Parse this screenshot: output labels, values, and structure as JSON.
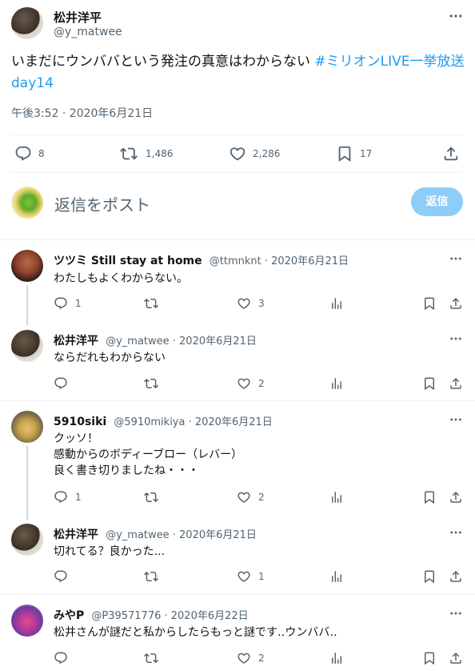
{
  "main": {
    "author_name": "松井洋平",
    "author_handle": "@y_matwee",
    "text_main": "いまだにウンババという発注の真意はわからない ",
    "hashtag_part1": "#ミリオンLIVE一挙放送",
    "hashtag_part2": "day14",
    "timestamp": "午後3:52 · 2020年6月21日",
    "replies": "8",
    "retweets": "1,486",
    "likes": "2,286",
    "bookmarks": "17"
  },
  "composer": {
    "placeholder": "返信をポスト",
    "button": "返信"
  },
  "replies": [
    {
      "name": "ツツミ Still stay at home",
      "meta": "@ttmnknt · 2020年6月21日",
      "lines": [
        "わたしもよくわからない。"
      ],
      "replies": "1",
      "retweets": "",
      "likes": "3"
    },
    {
      "name": "松井洋平",
      "meta": "@y_matwee · 2020年6月21日",
      "lines": [
        "ならだれもわからない"
      ],
      "replies": "",
      "retweets": "",
      "likes": "2"
    },
    {
      "name": "5910siki",
      "meta": "@5910mikiya · 2020年6月21日",
      "lines": [
        "クッソ！",
        "感動からのボディーブロー（レバー）",
        "良く書き切りましたね・・・"
      ],
      "replies": "1",
      "retweets": "",
      "likes": "2"
    },
    {
      "name": "松井洋平",
      "meta": "@y_matwee · 2020年6月21日",
      "lines": [
        "切れてる？良かった..."
      ],
      "replies": "",
      "retweets": "",
      "likes": "1"
    },
    {
      "name": "みやP",
      "meta": "@P39571776 · 2020年6月22日",
      "lines": [
        "松井さんが謎だと私からしたらもっと謎です‥ウンババ‥"
      ],
      "replies": "",
      "retweets": "",
      "likes": "2"
    }
  ],
  "icons": {
    "more": "more-icon",
    "reply": "reply-icon",
    "retweet": "retweet-icon",
    "like": "heart-icon",
    "bookmark": "bookmark-icon",
    "share": "share-icon",
    "views": "views-icon"
  },
  "colors": {
    "link": "#1d9bf0",
    "button_disabled": "#8ecdf8",
    "text": "#0f1419",
    "muted": "#536471",
    "divider": "#eff3f4"
  }
}
